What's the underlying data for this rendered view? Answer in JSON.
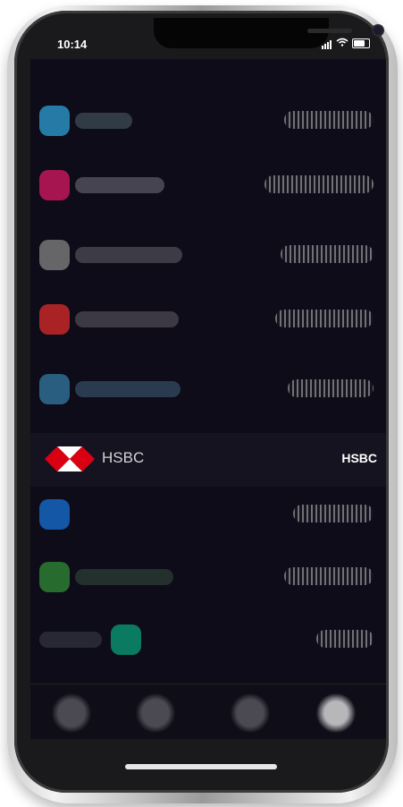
{
  "status_bar": {
    "time": "10:14"
  },
  "hsbc": {
    "logo_text": "HSBC",
    "right_label": "HSBC"
  },
  "colors": {
    "screen_bg": "#0d0c18",
    "hsbc_red": "#db0011",
    "row_accents": [
      "#2a8fbf",
      "#c2185b",
      "#777777",
      "#c62828",
      "#2f6d93",
      "#1565c0",
      "#2e7d32",
      "#0b8f6f"
    ]
  },
  "icons": {
    "signal": "signal-icon",
    "wifi": "wifi-icon",
    "battery": "battery-icon",
    "hsbc_logo": "hsbc-logo-icon"
  }
}
